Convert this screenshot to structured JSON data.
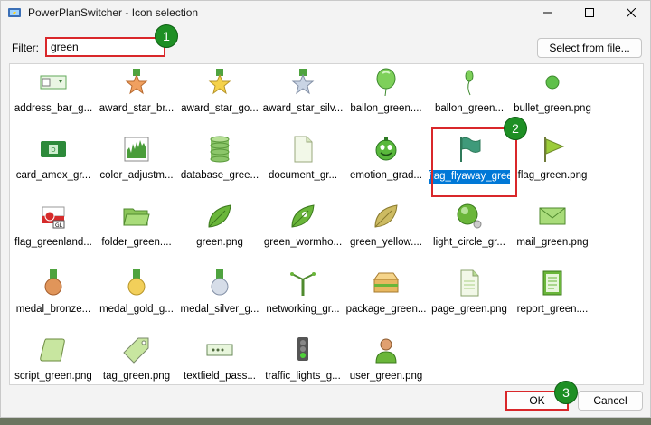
{
  "window": {
    "title": "PowerPlanSwitcher - Icon selection",
    "app_icon": "power-plan-icon"
  },
  "filter": {
    "label": "Filter:",
    "value": "green"
  },
  "buttons": {
    "select_from_file": "Select from file...",
    "ok": "OK",
    "cancel": "Cancel"
  },
  "badges": [
    "1",
    "2",
    "3"
  ],
  "icons": [
    {
      "label": "address_bar_g...",
      "icon": "address-bar-icon"
    },
    {
      "label": "award_star_br...",
      "icon": "award-star-bronze-icon"
    },
    {
      "label": "award_star_go...",
      "icon": "award-star-gold-icon"
    },
    {
      "label": "award_star_silv...",
      "icon": "award-star-silver-icon"
    },
    {
      "label": "ballon_green....",
      "icon": "balloon-icon"
    },
    {
      "label": "ballon_green...",
      "icon": "balloon-small-icon"
    },
    {
      "label": "bullet_green.png",
      "icon": "bullet-icon"
    },
    {
      "label": "card_amex_gr...",
      "icon": "card-amex-icon"
    },
    {
      "label": "color_adjustm...",
      "icon": "color-adjustment-icon"
    },
    {
      "label": "database_gree...",
      "icon": "database-icon"
    },
    {
      "label": "document_gr...",
      "icon": "document-icon"
    },
    {
      "label": "emotion_grad...",
      "icon": "emotion-icon"
    },
    {
      "label": "flag_flyaway_green.png",
      "icon": "flag-flyaway-icon"
    },
    {
      "label": "flag_green.png",
      "icon": "flag-icon"
    },
    {
      "label": "flag_greenland...",
      "icon": "flag-greenland-icon"
    },
    {
      "label": "folder_green....",
      "icon": "folder-icon"
    },
    {
      "label": "green.png",
      "icon": "leaf-icon"
    },
    {
      "label": "green_wormho...",
      "icon": "leaf-wormhole-icon"
    },
    {
      "label": "green_yellow....",
      "icon": "leaf-yellow-icon"
    },
    {
      "label": "light_circle_gr...",
      "icon": "light-circle-icon"
    },
    {
      "label": "mail_green.png",
      "icon": "mail-icon"
    },
    {
      "label": "medal_bronze...",
      "icon": "medal-bronze-icon"
    },
    {
      "label": "medal_gold_g...",
      "icon": "medal-gold-icon"
    },
    {
      "label": "medal_silver_g...",
      "icon": "medal-silver-icon"
    },
    {
      "label": "networking_gr...",
      "icon": "networking-icon"
    },
    {
      "label": "package_green...",
      "icon": "package-icon"
    },
    {
      "label": "page_green.png",
      "icon": "page-icon"
    },
    {
      "label": "report_green....",
      "icon": "report-icon"
    },
    {
      "label": "script_green.png",
      "icon": "script-icon"
    },
    {
      "label": "tag_green.png",
      "icon": "tag-icon"
    },
    {
      "label": "textfield_pass...",
      "icon": "textfield-password-icon"
    },
    {
      "label": "traffic_lights_g...",
      "icon": "traffic-lights-icon"
    },
    {
      "label": "user_green.png",
      "icon": "user-icon"
    }
  ],
  "selected_icon": "flag_flyaway_green.png",
  "colors": {
    "accent": "#0078d7",
    "highlight": "#d9272a",
    "badge": "#1e8f24"
  }
}
